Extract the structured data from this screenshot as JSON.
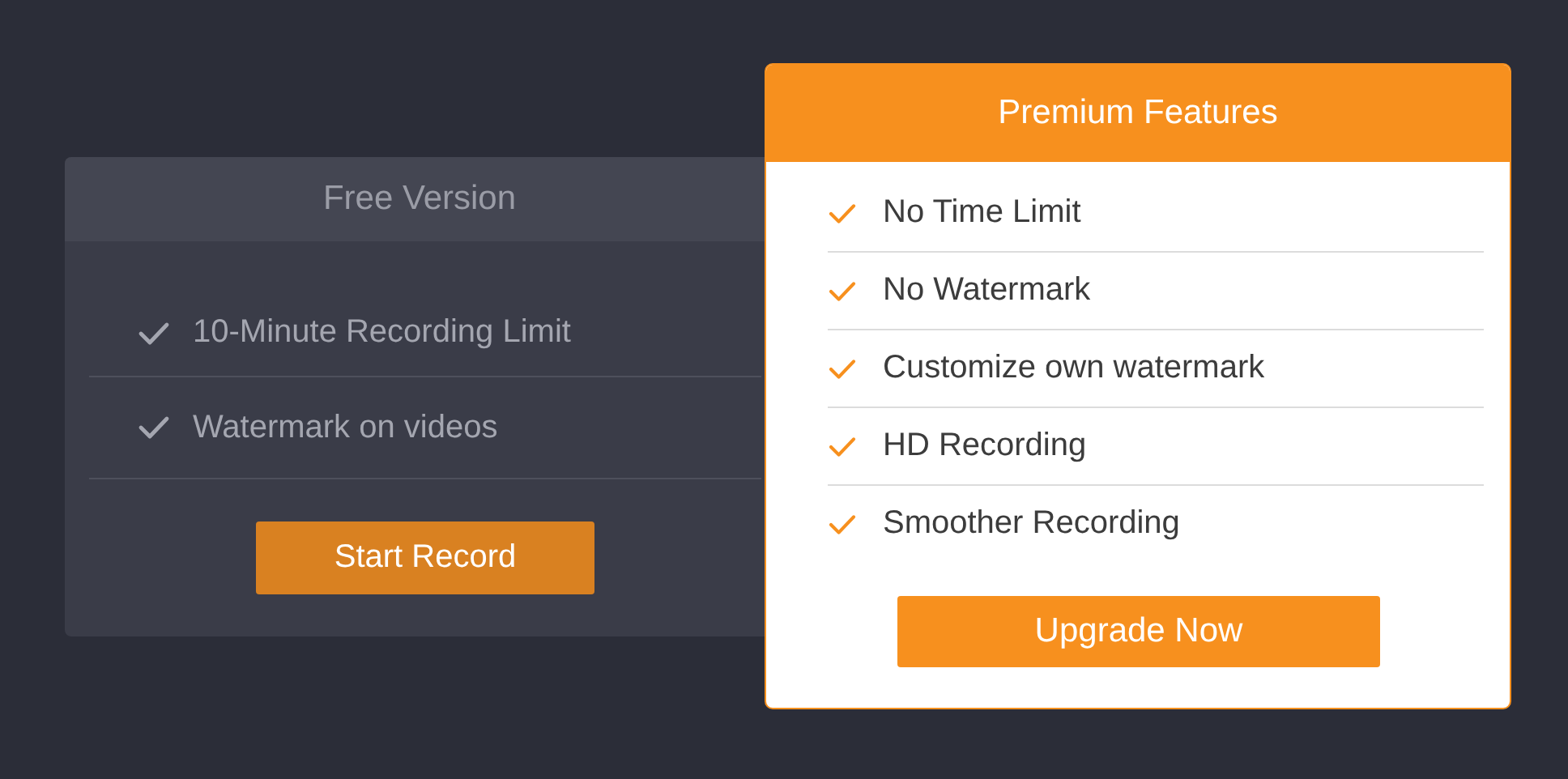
{
  "free_version": {
    "title": "Free Version",
    "features": [
      "10-Minute Recording Limit",
      "Watermark on videos"
    ],
    "button": "Start Record"
  },
  "premium_features": {
    "title": "Premium Features",
    "features": [
      "No Time Limit",
      "No Watermark",
      "Customize own watermark",
      "HD Recording",
      "Smoother Recording"
    ],
    "button": "Upgrade Now"
  }
}
